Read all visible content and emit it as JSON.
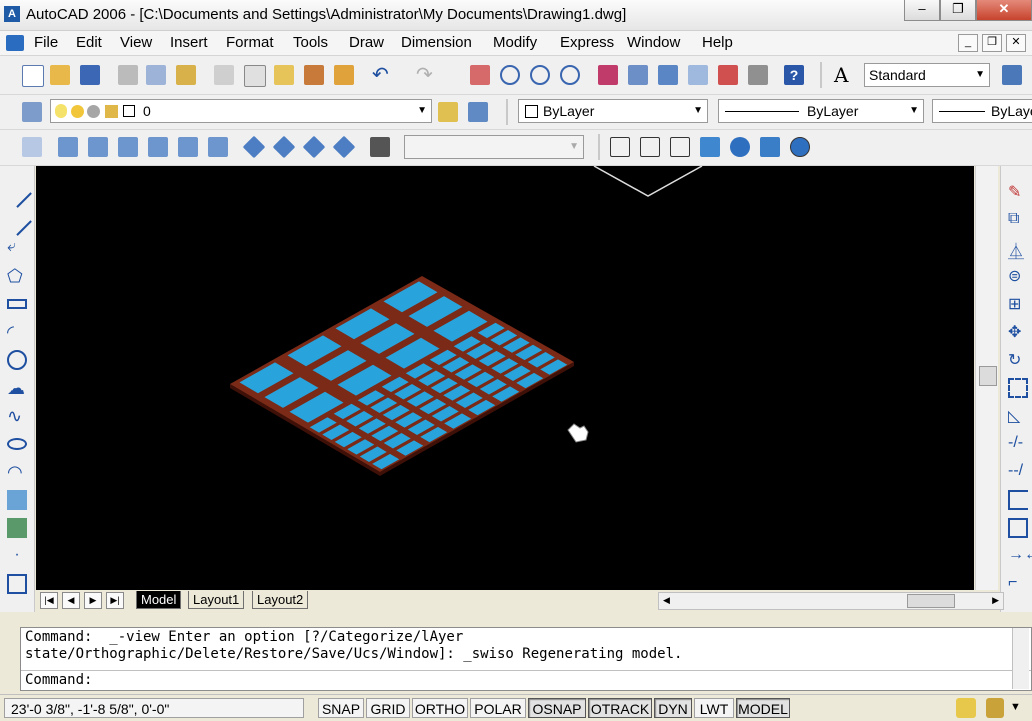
{
  "window": {
    "title": "AutoCAD 2006 - [C:\\Documents and Settings\\Administrator\\My Documents\\Drawing1.dwg]"
  },
  "menu": [
    "File",
    "Edit",
    "View",
    "Insert",
    "Format",
    "Tools",
    "Draw",
    "Dimension",
    "Modify",
    "Express",
    "Window",
    "Help"
  ],
  "toolbar": {
    "text_style": "Standard",
    "layer_name": "0",
    "color_control": "ByLayer",
    "linetype_control": "ByLayer",
    "lineweight_control": "ByLayer"
  },
  "layout_tabs": [
    "Model",
    "Layout1",
    "Layout2"
  ],
  "active_tab": "Model",
  "command_window": {
    "history_line_1": "Command:  _-view Enter an option [?/Categorize/lAyer",
    "history_line_2": "state/Orthographic/Delete/Restore/Save/Ucs/Window]: _swiso Regenerating model.",
    "prompt": "Command:"
  },
  "status_bar": {
    "coordinates": "23'-0 3/8\",  -1'-8 5/8\", 0'-0\"",
    "buttons": [
      {
        "label": "SNAP",
        "on": false
      },
      {
        "label": "GRID",
        "on": false
      },
      {
        "label": "ORTHO",
        "on": false
      },
      {
        "label": "POLAR",
        "on": false
      },
      {
        "label": "OSNAP",
        "on": true
      },
      {
        "label": "OTRACK",
        "on": true
      },
      {
        "label": "DYN",
        "on": true
      },
      {
        "label": "LWT",
        "on": false
      },
      {
        "label": "MODEL",
        "on": true
      }
    ]
  },
  "colors": {
    "frame": "#7a2a16",
    "pane": "#29a3dc",
    "canvas": "#000000"
  }
}
